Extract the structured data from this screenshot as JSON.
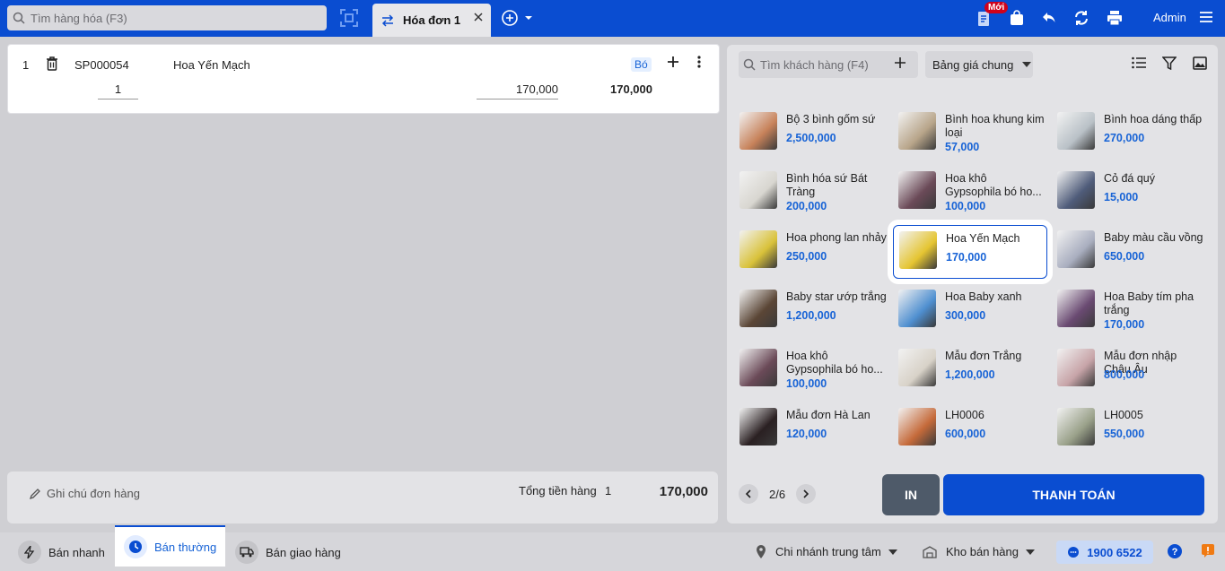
{
  "search": {
    "placeholder": "Tìm hàng hóa (F3)"
  },
  "tab": {
    "label": "Hóa đơn 1"
  },
  "header": {
    "new_badge": "Mới",
    "user": "Admin"
  },
  "cart": {
    "items": [
      {
        "index": "1",
        "code": "SP000054",
        "name": "Hoa Yến Mạch",
        "unit": "Bó",
        "quantity": "1",
        "price": "170,000",
        "total": "170,000"
      }
    ],
    "note_placeholder": "Ghi chú đơn hàng",
    "sum_label": "Tổng tiền hàng",
    "sum_count": "1",
    "sum_total": "170,000"
  },
  "customer": {
    "placeholder": "Tìm khách hàng (F4)"
  },
  "price_list": {
    "label": "Bảng giá chung"
  },
  "products": [
    {
      "name": "Bộ 3 bình gốm sứ",
      "price": "2,500,000",
      "color": "#c7825a"
    },
    {
      "name": "Bình hoa khung kim loại",
      "price": "57,000",
      "color": "#b8a58a"
    },
    {
      "name": "Bình hoa dáng thấp",
      "price": "270,000",
      "color": "#b9c1c7"
    },
    {
      "name": "Bình hóa sứ Bát Tràng",
      "price": "200,000",
      "color": "#d8d6d0"
    },
    {
      "name": "Hoa khô Gypsophila bó ho...",
      "price": "100,000",
      "color": "#6b4a58"
    },
    {
      "name": "Cỏ đá quý",
      "price": "15,000",
      "color": "#4f5c7a"
    },
    {
      "name": "Hoa phong lan nhảy",
      "price": "250,000",
      "color": "#d9c23a"
    },
    {
      "name": "Hoa Yến Mạch",
      "price": "170,000",
      "color": "#e5c532",
      "selected": true
    },
    {
      "name": "Baby màu cầu vồng",
      "price": "650,000",
      "color": "#a9aebf"
    },
    {
      "name": "Baby star ướp trắng",
      "price": "1,200,000",
      "color": "#5b4636"
    },
    {
      "name": "Hoa Baby xanh",
      "price": "300,000",
      "color": "#4f8fd0"
    },
    {
      "name": "Hoa Baby tím pha trắng",
      "price": "170,000",
      "color": "#6a4a72"
    },
    {
      "name": "Hoa khô Gypsophila bó ho...",
      "price": "100,000",
      "color": "#6b4a58"
    },
    {
      "name": "Mẫu đơn Trắng",
      "price": "1,200,000",
      "color": "#d8d2c8"
    },
    {
      "name": "Mẫu đơn nhập Châu Âu",
      "price": "800,000",
      "color": "#c7a4a8"
    },
    {
      "name": "Mẫu đơn Hà Lan",
      "price": "120,000",
      "color": "#2a2022"
    },
    {
      "name": "LH0006",
      "price": "600,000",
      "color": "#c56a3a"
    },
    {
      "name": "LH0005",
      "price": "550,000",
      "color": "#9aa18a"
    }
  ],
  "pager": {
    "text": "2/6"
  },
  "actions": {
    "print": "IN",
    "pay": "THANH TOÁN"
  },
  "footer": {
    "modes": [
      "Bán nhanh",
      "Bán thường",
      "Bán giao hàng"
    ],
    "branch": "Chi nhánh trung tâm",
    "warehouse": "Kho bán hàng",
    "hotline": "1900 6522"
  }
}
